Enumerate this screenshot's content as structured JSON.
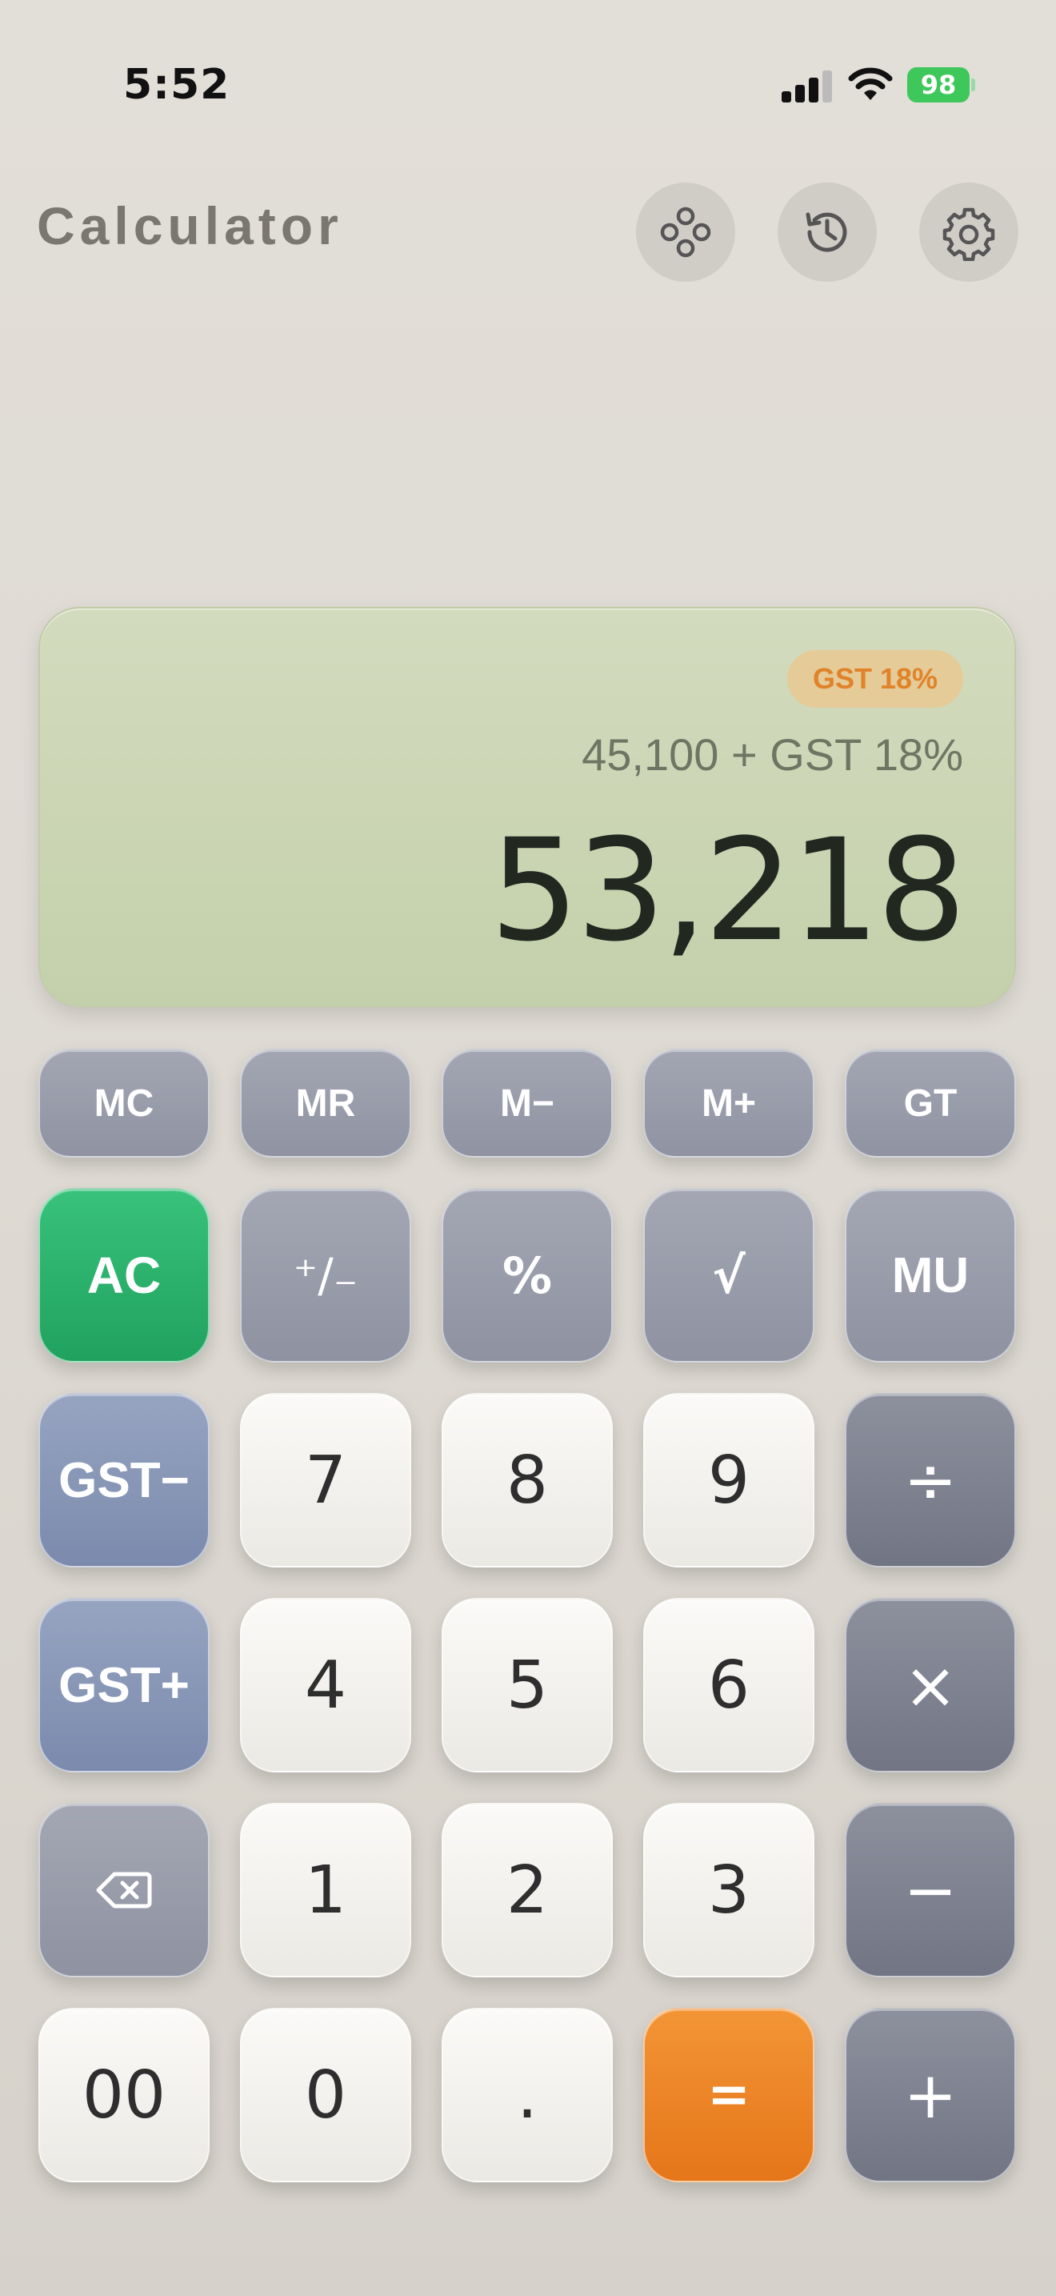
{
  "status_bar": {
    "time": "5:52",
    "battery_level": "98"
  },
  "header": {
    "title": "Calculator"
  },
  "display": {
    "badge": "GST 18%",
    "expression": "45,100 + GST 18%",
    "result": "53,218",
    "accent_color": "#e0832a"
  },
  "memory_row": [
    "MC",
    "MR",
    "M−",
    "M+",
    "GT"
  ],
  "keys": {
    "ac": "AC",
    "plus_minus": "⁺∕₋",
    "percent": "%",
    "sqrt": "√",
    "mu": "MU",
    "gst_minus": "GST−",
    "gst_plus": "GST+",
    "seven": "7",
    "eight": "8",
    "nine": "9",
    "divide": "÷",
    "four": "4",
    "five": "5",
    "six": "6",
    "multiply": "×",
    "one": "1",
    "two": "2",
    "three": "3",
    "minus": "−",
    "double_zero": "00",
    "zero": "0",
    "decimal": ".",
    "equals": "=",
    "plus": "+"
  },
  "icons": {
    "header": [
      "mode-switch-icon",
      "history-icon",
      "gear-icon"
    ],
    "backspace": "backspace-icon"
  },
  "colors": {
    "ac": "#2bb56b",
    "equals": "#ee8628",
    "gst": "#8896b7",
    "display": "#ccd6b5"
  }
}
